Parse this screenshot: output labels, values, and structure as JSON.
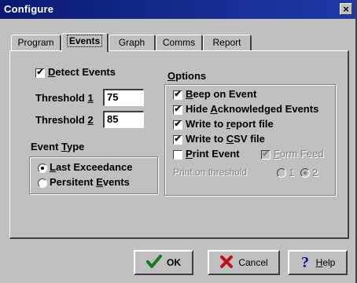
{
  "window": {
    "title": "Configure",
    "close_symbol": "×"
  },
  "tabs": [
    {
      "label": "Program",
      "active": false
    },
    {
      "label": "Events",
      "active": true
    },
    {
      "label": "Graph",
      "active": false
    },
    {
      "label": "Comms",
      "active": false
    },
    {
      "label": "Report",
      "active": false
    }
  ],
  "events": {
    "detect": {
      "label_u": "D",
      "label_rest": "etect Events",
      "checked": true,
      "mark": "✔"
    },
    "threshold1": {
      "label_pre": "Threshold ",
      "label_u": "1",
      "value": "75"
    },
    "threshold2": {
      "label_pre": "Threshold ",
      "label_u": "2",
      "value": "85"
    },
    "event_type": {
      "label_pre": "Event ",
      "label_u": "T",
      "label_rest": "ype",
      "options": [
        {
          "u": "L",
          "rest": "ast Exceedance",
          "selected": true
        },
        {
          "pre": "Persitent ",
          "u": "E",
          "rest": "vents",
          "selected": false
        }
      ]
    }
  },
  "options": {
    "label_u": "O",
    "label_rest": "ptions",
    "items": [
      {
        "u": "B",
        "rest": "eep on Event",
        "checked": true,
        "mark": "✔"
      },
      {
        "pre": "Hide ",
        "u": "A",
        "rest": "cknowledged Events",
        "checked": true,
        "mark": "✔"
      },
      {
        "pre": "Write to ",
        "u": "r",
        "rest": "eport file",
        "checked": true,
        "mark": "✔"
      },
      {
        "pre": "Write to ",
        "u": "C",
        "rest": "SV file",
        "checked": true,
        "mark": "✔"
      }
    ],
    "print_event": {
      "u": "P",
      "rest": "rint Event",
      "checked": false
    },
    "form_feed": {
      "u": "F",
      "rest": "orm Feed",
      "checked": true,
      "disabled": true,
      "mark": "✔"
    },
    "print_threshold": {
      "label": "Print on threshold",
      "opt1": "1",
      "opt2": "2",
      "selected": "2"
    }
  },
  "buttons": {
    "ok": {
      "label": "OK",
      "icon": "checkmark-icon"
    },
    "cancel": {
      "label": "Cancel",
      "icon": "x-icon"
    },
    "help": {
      "u": "H",
      "rest": "elp",
      "icon": "question-icon"
    }
  },
  "colors": {
    "title_bar": "#0a1a72",
    "ok_icon": "#1a7a1a",
    "cancel_icon": "#c01010",
    "help_icon": "#1010a0",
    "desktop": "#1f8a2c"
  }
}
